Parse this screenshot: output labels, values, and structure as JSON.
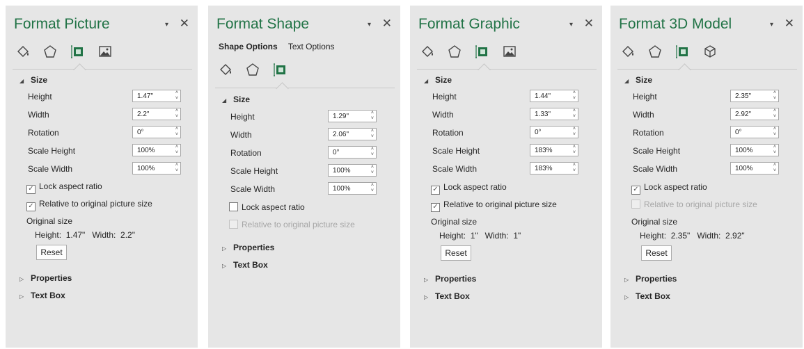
{
  "colors": {
    "title": "#217346",
    "pane_bg": "#e6e6e6",
    "icon_accent": "#217346"
  },
  "icons": [
    "fill-line-icon",
    "effects-pentagon-icon",
    "size-properties-icon",
    "picture-icon",
    "3d-model-icon"
  ],
  "common": {
    "dropdown_glyph": "▾",
    "close_glyph": "✕",
    "expanded_glyph": "◢",
    "collapsed_glyph": "▷",
    "spin_up": "˄",
    "spin_down": "˅",
    "check_glyph": "✓",
    "size": "Size",
    "height": "Height",
    "width": "Width",
    "rotation": "Rotation",
    "scale_height": "Scale Height",
    "scale_width": "Scale Width",
    "lock_aspect": "Lock aspect ratio",
    "relative": "Relative to original picture size",
    "original_size": "Original size",
    "height_label": "Height:",
    "width_label": "Width:",
    "reset": "Reset",
    "properties": "Properties",
    "text_box": "Text Box"
  },
  "panes": {
    "picture": {
      "title": "Format Picture",
      "height": "1.47\"",
      "width": "2.2\"",
      "rotation": "0°",
      "scale_height": "100%",
      "scale_width": "100%",
      "lock_checked": true,
      "relative_checked": true,
      "orig_height": "1.47\"",
      "orig_width": "2.2\""
    },
    "shape": {
      "title": "Format Shape",
      "shape_options": "Shape Options",
      "text_options": "Text Options",
      "height": "1.29\"",
      "width": "2.06\"",
      "rotation": "0°",
      "scale_height": "100%",
      "scale_width": "100%",
      "lock_checked": false,
      "relative_checked": false
    },
    "graphic": {
      "title": "Format Graphic",
      "height": "1.44\"",
      "width": "1.33\"",
      "rotation": "0°",
      "scale_height": "183%",
      "scale_width": "183%",
      "lock_checked": true,
      "relative_checked": true,
      "orig_height": "1\"",
      "orig_width": "1\""
    },
    "model3d": {
      "title": "Format 3D Model",
      "height": "2.35\"",
      "width": "2.92\"",
      "rotation": "0°",
      "scale_height": "100%",
      "scale_width": "100%",
      "lock_checked": true,
      "relative_checked": false,
      "orig_height": "2.35\"",
      "orig_width": "2.92\""
    }
  }
}
